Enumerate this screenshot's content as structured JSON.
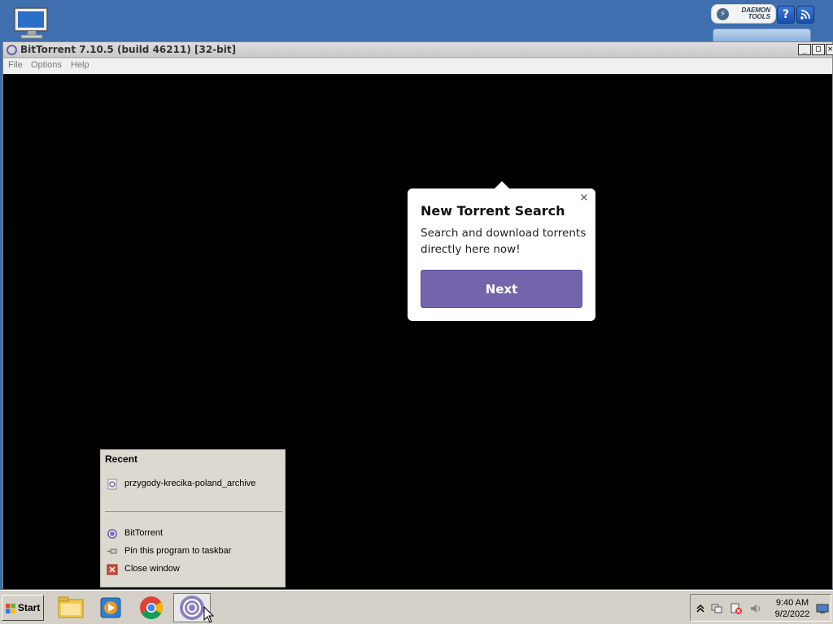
{
  "window": {
    "title": "BitTorrent 7.10.5  (build 46211) [32-bit]",
    "menu": [
      "File",
      "Options",
      "Help"
    ],
    "controls": {
      "minimize": "_",
      "maximize": "□",
      "close": "✕"
    }
  },
  "tooltip": {
    "title": "New Torrent Search",
    "body": "Search and download torrents directly here now!",
    "next_label": "Next",
    "close_symbol": "×",
    "accent_color": "#7464ab"
  },
  "jumplist": {
    "heading": "Recent",
    "recent_items": [
      "przygody-krecika-poland_archive"
    ],
    "tasks": [
      {
        "label": "BitTorrent",
        "icon": "bittorrent-icon"
      },
      {
        "label": "Pin this program to taskbar",
        "icon": "pin-icon"
      },
      {
        "label": "Close window",
        "icon": "close-icon"
      }
    ]
  },
  "gadget": {
    "logo_line1": "DAEMON",
    "logo_line2": "TOOLS",
    "help_symbol": "?",
    "rss_icon": "rss-icon"
  },
  "taskbar": {
    "start_label": "Start",
    "pinned": [
      "folder-icon",
      "media-player-icon",
      "chrome-icon",
      "bittorrent-icon"
    ],
    "tray_icons": [
      "chevron-up-icon",
      "network-icon",
      "action-center-icon",
      "volume-icon"
    ],
    "time": "9:40 AM",
    "date": "9/2/2022",
    "show_desktop_icon": "show-desktop-icon"
  }
}
